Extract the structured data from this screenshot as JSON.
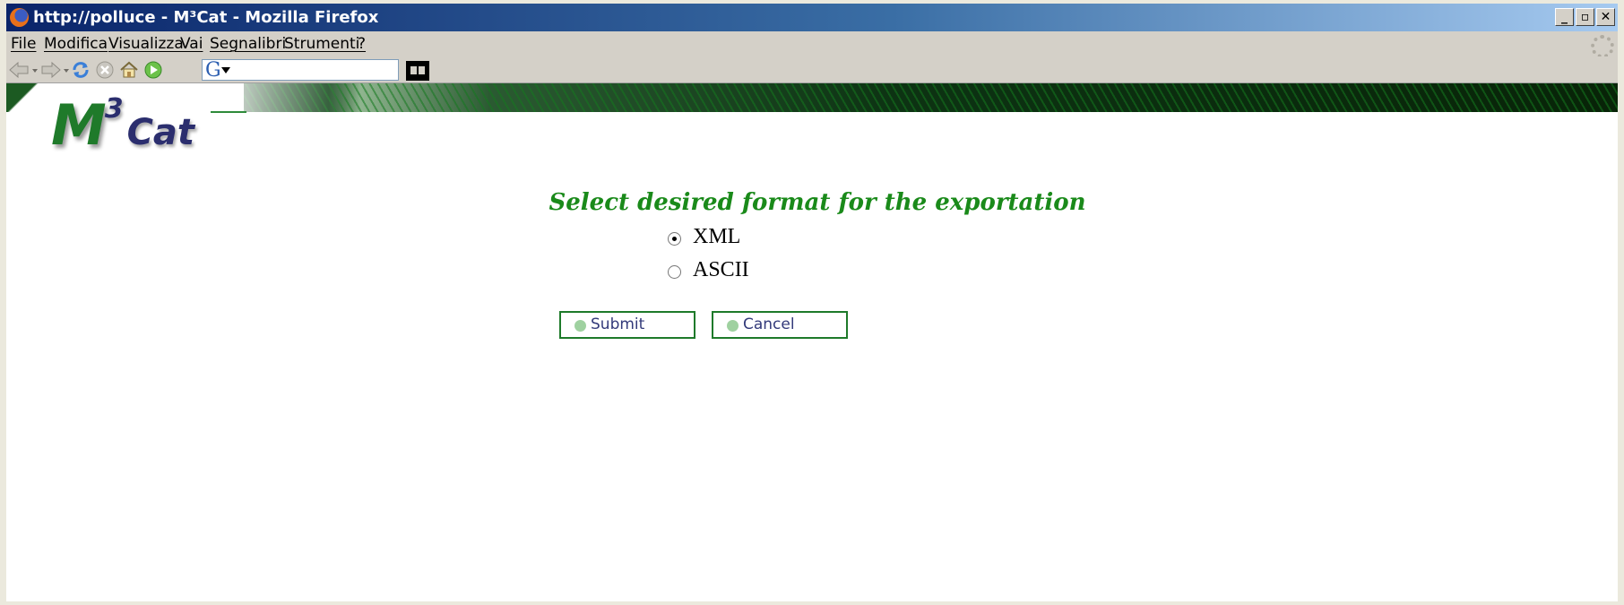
{
  "window": {
    "title": "http://polluce - M³Cat - Mozilla Firefox",
    "controls": [
      "_",
      "▫",
      "✕"
    ]
  },
  "menu": {
    "items": [
      "File",
      "Modifica",
      "Visualizza",
      "Vai",
      "Segnalibri",
      "Strumenti",
      "?"
    ]
  },
  "toolbar": {
    "buttons": [
      "back-icon",
      "forward-icon",
      "reload-icon",
      "stop-icon",
      "home-icon",
      "go-icon"
    ],
    "search_engine_letter": "G",
    "search_value": ""
  },
  "logo": {
    "main": "M",
    "sup": "3",
    "suffix": "Cat"
  },
  "form": {
    "heading": "Select desired format for the exportation",
    "options": [
      {
        "label": "XML",
        "checked": true
      },
      {
        "label": "ASCII",
        "checked": false
      }
    ],
    "submit_label": "Submit",
    "cancel_label": "Cancel"
  },
  "colors": {
    "accent_green": "#1a8a1a",
    "button_border": "#1e7a2a",
    "button_text": "#333a7a",
    "titlebar_start": "#0a246a"
  }
}
